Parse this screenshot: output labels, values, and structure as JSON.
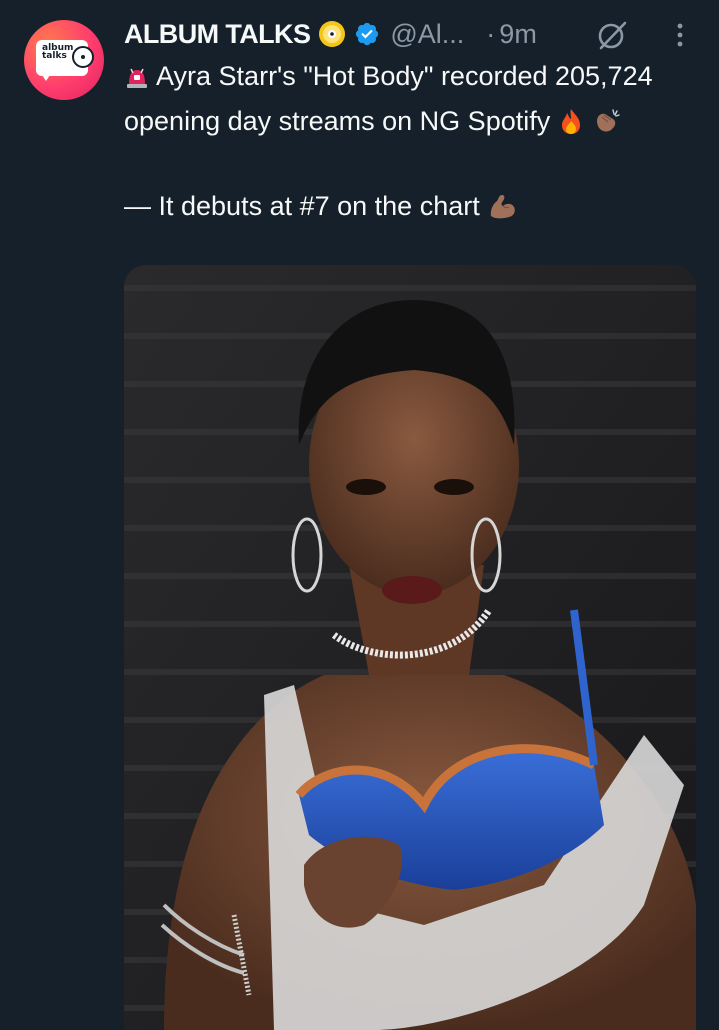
{
  "account": {
    "display_name": "ALBUM TALKS",
    "handle": "@Al...",
    "separator": "·",
    "time": "9m",
    "avatar_text_line1": "album",
    "avatar_text_line2": "talks"
  },
  "tweet": {
    "line1_prefix_emoji": "police-light-emoji",
    "line1": "Ayra Starr's \"Hot Body\" recorded 205,724 opening day streams on NG Spotify",
    "line1_suffix_emojis": [
      "fire-emoji",
      "clapping-hands-emoji"
    ],
    "line2": "— It debuts at #7 on the chart",
    "line2_suffix_emoji": "flexed-biceps-emoji"
  },
  "media": {
    "kind": "photo",
    "description_icon": "photo-icon"
  },
  "icons": {
    "badge": "cd-badge-icon",
    "verified": "verified-badge-icon",
    "grok": "grok-icon",
    "more": "more-options-icon"
  },
  "colors": {
    "background": "#15202b",
    "text_primary": "#f7f9f9",
    "text_secondary": "#8b98a5",
    "verified_blue": "#1d9bf0",
    "avatar_gradient_start": "#ff7a4d",
    "avatar_gradient_end": "#e0245e"
  }
}
